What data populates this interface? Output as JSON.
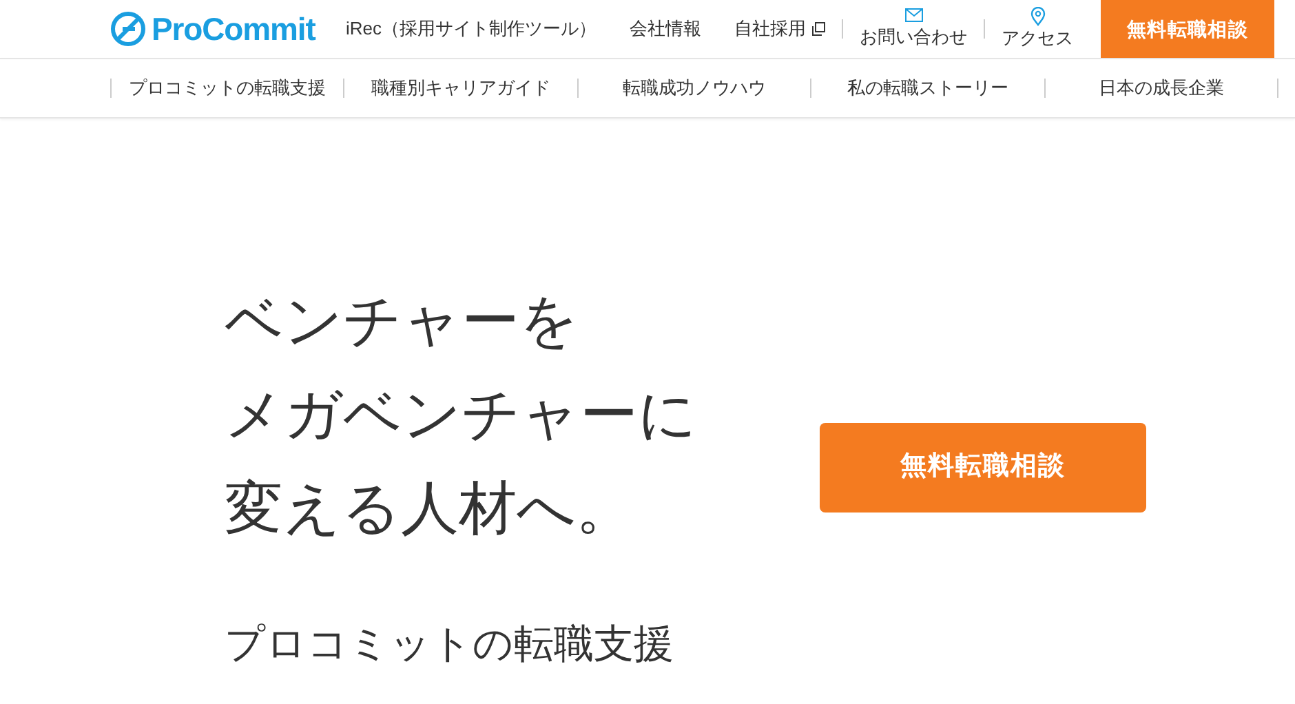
{
  "header": {
    "logo": "ProCommit",
    "links": [
      {
        "label": "iRec（採用サイト制作ツール）",
        "kind": "text"
      },
      {
        "label": "会社情報",
        "kind": "text"
      },
      {
        "label": "自社採用",
        "kind": "external"
      },
      {
        "label": "お問い合わせ",
        "kind": "mail"
      },
      {
        "label": "アクセス",
        "kind": "pin"
      }
    ],
    "cta": "無料転職相談"
  },
  "nav": [
    "プロコミットの転職支援",
    "職種別キャリアガイド",
    "転職成功ノウハウ",
    "私の転職ストーリー",
    "日本の成長企業"
  ],
  "hero": {
    "heading": [
      "ベンチャーを",
      "メガベンチャーに",
      "変える人材へ。"
    ],
    "cta": "無料転職相談",
    "subtitle": "プロコミットの転職支援"
  }
}
